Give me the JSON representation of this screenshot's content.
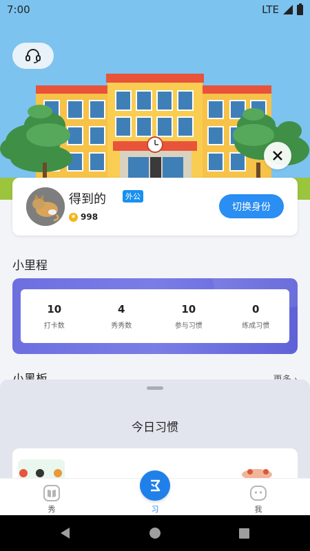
{
  "status_bar": {
    "time": "7:00",
    "network": "LTE"
  },
  "header": {
    "support_icon": "headset-icon",
    "close_icon": "close-icon"
  },
  "profile": {
    "name": "得到的",
    "tag": "外公",
    "points": "998",
    "switch_label": "切换身份"
  },
  "milestone": {
    "title": "小里程",
    "stats": [
      {
        "value": "10",
        "label": "打卡数"
      },
      {
        "value": "4",
        "label": "秀秀数"
      },
      {
        "value": "10",
        "label": "参与习惯"
      },
      {
        "value": "0",
        "label": "练成习惯"
      }
    ]
  },
  "board": {
    "title": "小黑板",
    "more": "更多 ›"
  },
  "sheet": {
    "title": "今日习惯"
  },
  "tabs": [
    {
      "label": "秀",
      "icon": "book-icon"
    },
    {
      "label": "习",
      "icon": "habit-icon"
    },
    {
      "label": "我",
      "icon": "face-icon"
    }
  ],
  "colors": {
    "accent": "#2a8ef2",
    "milestone": "#6d6fe0",
    "sky": "#7cc3ef"
  }
}
